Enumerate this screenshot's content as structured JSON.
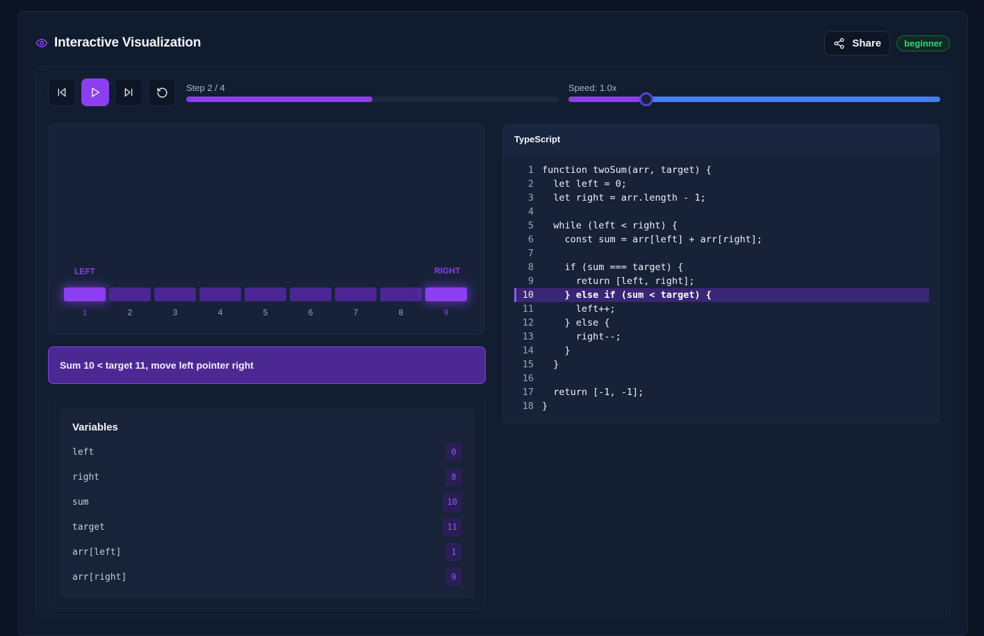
{
  "header": {
    "title": "Interactive Visualization",
    "share_label": "Share",
    "level_badge": "beginner"
  },
  "controls": {
    "step_label": "Step 2 / 4",
    "progress_fraction": 0.5,
    "speed_label": "Speed: 1.0x",
    "speed_fraction": 0.21
  },
  "visualization": {
    "left_label": "LEFT",
    "right_label": "RIGHT",
    "cells": [
      {
        "index": "1",
        "active": true
      },
      {
        "index": "2",
        "active": false
      },
      {
        "index": "3",
        "active": false
      },
      {
        "index": "4",
        "active": false
      },
      {
        "index": "5",
        "active": false
      },
      {
        "index": "6",
        "active": false
      },
      {
        "index": "7",
        "active": false
      },
      {
        "index": "8",
        "active": false
      },
      {
        "index": "9",
        "active": true
      }
    ]
  },
  "message": "Sum 10 < target 11, move left pointer right",
  "variables": {
    "title": "Variables",
    "items": [
      {
        "name": "left",
        "value": "0"
      },
      {
        "name": "right",
        "value": "8"
      },
      {
        "name": "sum",
        "value": "10"
      },
      {
        "name": "target",
        "value": "11"
      },
      {
        "name": "arr[left]",
        "value": "1"
      },
      {
        "name": "arr[right]",
        "value": "9"
      }
    ]
  },
  "code": {
    "language": "TypeScript",
    "highlighted_line": 10,
    "lines": [
      "function twoSum(arr, target) {",
      "  let left = 0;",
      "  let right = arr.length - 1;",
      "",
      "  while (left < right) {",
      "    const sum = arr[left] + arr[right];",
      "",
      "    if (sum === target) {",
      "      return [left, right];",
      "    } else if (sum < target) {",
      "      left++;",
      "    } else {",
      "      right--;",
      "    }",
      "  }",
      "",
      "  return [-1, -1];",
      "}"
    ]
  },
  "colors": {
    "accent": "#8b3ff0",
    "speed_track": "#3b82f6",
    "badge_green": "#34d27f"
  }
}
